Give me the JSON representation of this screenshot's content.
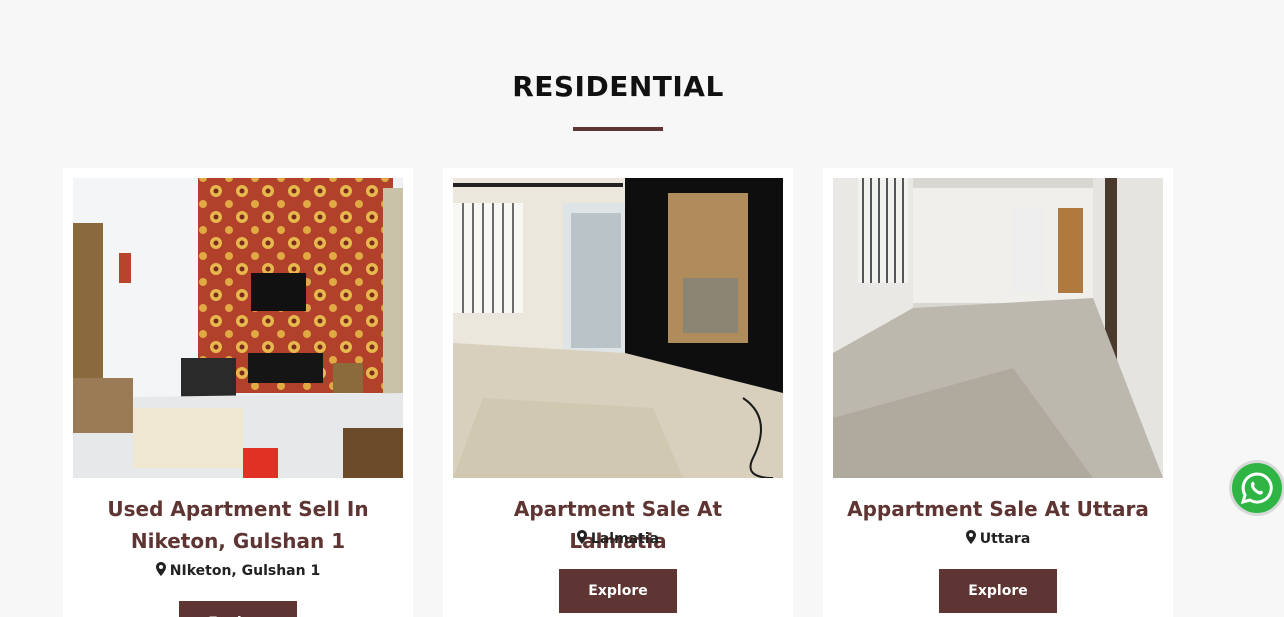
{
  "section": {
    "title": "RESIDENTIAL"
  },
  "colors": {
    "accent": "#5e3532",
    "background": "#f7f7f7",
    "whatsapp": "#2fb544"
  },
  "cards": [
    {
      "title": "Used Apartment Sell In Niketon, Gulshan 1",
      "location": "NIketon, Gulshan 1",
      "button": "Explore",
      "image_icon": "living-room-photo"
    },
    {
      "title": "Apartment Sale At Lalmatia",
      "location": "Lalmatia",
      "button": "Explore",
      "image_icon": "bedroom-photo"
    },
    {
      "title": "Appartment Sale At Uttara",
      "location": "Uttara",
      "button": "Explore",
      "image_icon": "hallway-photo"
    }
  ],
  "icons": {
    "location": "map-pin-icon",
    "whatsapp": "whatsapp-icon"
  }
}
